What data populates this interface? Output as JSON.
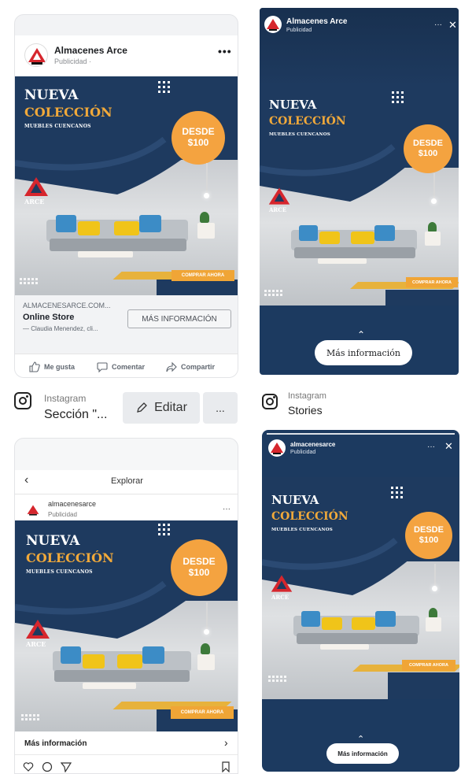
{
  "colors": {
    "navy": "#1e3a5f",
    "orange": "#f4a340",
    "yellow": "#e7b23c",
    "fb_gray": "#f2f3f5",
    "brand_red": "#d6262d"
  },
  "creative": {
    "title_line1": "NUEVA",
    "title_line2": "COLECCIÓN",
    "subtitle": "MUEBLES CUENCANOS",
    "badge_line1": "DESDE",
    "badge_line2": "$100",
    "cta": "COMPRAR AHORA",
    "logo_text": "ARCE"
  },
  "facebook_feed": {
    "page_name": "Almacenes Arce",
    "sponsored": "Publicidad ·",
    "more_icon": "more-dots-icon",
    "link_domain": "ALMACENESARCE.COM...",
    "link_title": "Online Store",
    "link_desc": "— Claudia Menendez, cli...",
    "cta_button": "MÁS INFORMACIÓN",
    "actions": [
      "Me gusta",
      "Comentar",
      "Compartir"
    ]
  },
  "facebook_story": {
    "page_name": "Almacenes Arce",
    "sponsored": "Publicidad",
    "menu_icons": [
      "more-dots-icon",
      "close-icon"
    ],
    "cta_button": "Más información"
  },
  "instagram_feed": {
    "platform": "Instagram",
    "section": "Sección \"...",
    "edit_button": "Editar",
    "more_button": "...",
    "nav_title": "Explorar",
    "account": "almacenesarce",
    "sponsored": "Publicidad",
    "more_info": "Más información"
  },
  "instagram_story": {
    "platform": "Instagram",
    "placement": "Stories",
    "account": "almacenesarce",
    "sponsored": "Publicidad",
    "cta_button": "Más información"
  }
}
